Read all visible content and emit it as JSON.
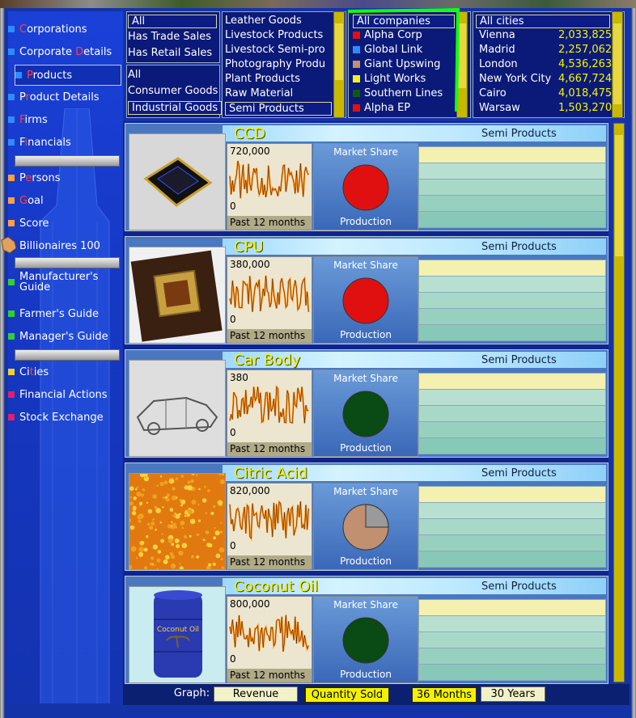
{
  "sidebar": {
    "items": [
      {
        "pre": "",
        "hot": "C",
        "post": "orporations",
        "color": "#2f8cff"
      },
      {
        "pre": "Corporate ",
        "hot": "D",
        "post": "etails",
        "color": "#2f8cff"
      },
      {
        "pre": "",
        "hot": "P",
        "post": "roducts",
        "color": "#2f8cff"
      },
      {
        "pre": "P",
        "hot": "r",
        "post": "oduct Details",
        "color": "#2f8cff"
      },
      {
        "pre": "",
        "hot": "F",
        "post": "irms",
        "color": "#2f8cff"
      },
      {
        "pre": "F",
        "hot": "i",
        "post": "nancials",
        "color": "#2f8cff"
      },
      {
        "pre": "P",
        "hot": "e",
        "post": "rsons",
        "color": "#ffa040"
      },
      {
        "pre": "",
        "hot": "G",
        "post": "oal",
        "color": "#ffa040"
      },
      {
        "pre": "Score",
        "hot": "",
        "post": "",
        "color": "#ffa040"
      },
      {
        "pre": "Billionaires 100",
        "hot": "",
        "post": "",
        "color": "#ffa040"
      },
      {
        "pre": "Manufacturer's",
        "hot": "",
        "post": "",
        "color": "#30d030",
        "line2": "Guide"
      },
      {
        "pre": "Farmer's Guide",
        "hot": "",
        "post": "",
        "color": "#30d030"
      },
      {
        "pre": "Manager's Guide",
        "hot": "",
        "post": "",
        "color": "#30d030"
      },
      {
        "pre": "Ci",
        "hot": "t",
        "post": "ies",
        "color": "#f0d030"
      },
      {
        "pre": "Financial Actions",
        "hot": "",
        "post": "",
        "color": "#e0206a"
      },
      {
        "pre": "Stock Exchange",
        "hot": "",
        "post": "",
        "color": "#e0206a"
      }
    ]
  },
  "filters": {
    "sales": [
      "All",
      "Has Trade Sales",
      "Has Retail Sales"
    ],
    "goods": [
      "All",
      "Consumer Goods",
      "Industrial Goods"
    ],
    "categories": [
      "Leather Goods",
      "Livestock Products",
      "Livestock Semi-pro",
      "Photography Produ",
      "Plant Products",
      "Raw Material",
      "Semi Products"
    ],
    "companies": [
      {
        "name": "All companies",
        "color": ""
      },
      {
        "name": "Alpha Corp",
        "color": "#e01010"
      },
      {
        "name": "Global Link",
        "color": "#2f8cff"
      },
      {
        "name": "Giant Upswing",
        "color": "#c09070"
      },
      {
        "name": "Light Works",
        "color": "#f0f020"
      },
      {
        "name": "Southern Lines",
        "color": "#105a10"
      },
      {
        "name": "Alpha EP",
        "color": "#e01010"
      }
    ],
    "cities_header": "All cities",
    "cities": [
      {
        "name": "Vienna",
        "pop": "2,033,825"
      },
      {
        "name": "Madrid",
        "pop": "2,257,062"
      },
      {
        "name": "London",
        "pop": "4,536,263"
      },
      {
        "name": "New York City",
        "pop": "4,667,724"
      },
      {
        "name": "Cairo",
        "pop": "4,018,475"
      },
      {
        "name": "Warsaw",
        "pop": "1,503,270"
      }
    ]
  },
  "products": [
    {
      "name": "CCD",
      "category": "Semi Products",
      "ymax": "720,000",
      "yzero": "0",
      "period": "Past 12 months",
      "ms_label": "Market Share",
      "prod_label": "Production",
      "share_color": "#e01010",
      "share_pie": 0,
      "img": "chip"
    },
    {
      "name": "CPU",
      "category": "Semi Products",
      "ymax": "380,000",
      "yzero": "0",
      "period": "Past 12 months",
      "ms_label": "Market Share",
      "prod_label": "Production",
      "share_color": "#e01010",
      "share_pie": 0,
      "img": "cpu"
    },
    {
      "name": "Car Body",
      "category": "Semi Products",
      "ymax": "380",
      "yzero": "0",
      "period": "Past 12 months",
      "ms_label": "Market Share",
      "prod_label": "Production",
      "share_color": "#0a4a14",
      "share_pie": 0,
      "img": "car"
    },
    {
      "name": "Citric Acid",
      "category": "Semi Products",
      "ymax": "820,000",
      "yzero": "0",
      "period": "Past 12 months",
      "ms_label": "Market Share",
      "prod_label": "Production",
      "share_color": "#c09070",
      "share_pie": 0.25,
      "img": "citric"
    },
    {
      "name": "Coconut Oil",
      "category": "Semi Products",
      "ymax": "800,000",
      "yzero": "0",
      "period": "Past 12 months",
      "ms_label": "Market Share",
      "prod_label": "Production",
      "share_color": "#0a4a14",
      "share_pie": 0,
      "img": "barrel",
      "barrel_text": "Coconut Oil"
    }
  ],
  "bottom": {
    "graph_label": "Graph:",
    "buttons": [
      "Revenue",
      "Quantity Sold",
      "36 Months",
      "30 Years"
    ]
  }
}
